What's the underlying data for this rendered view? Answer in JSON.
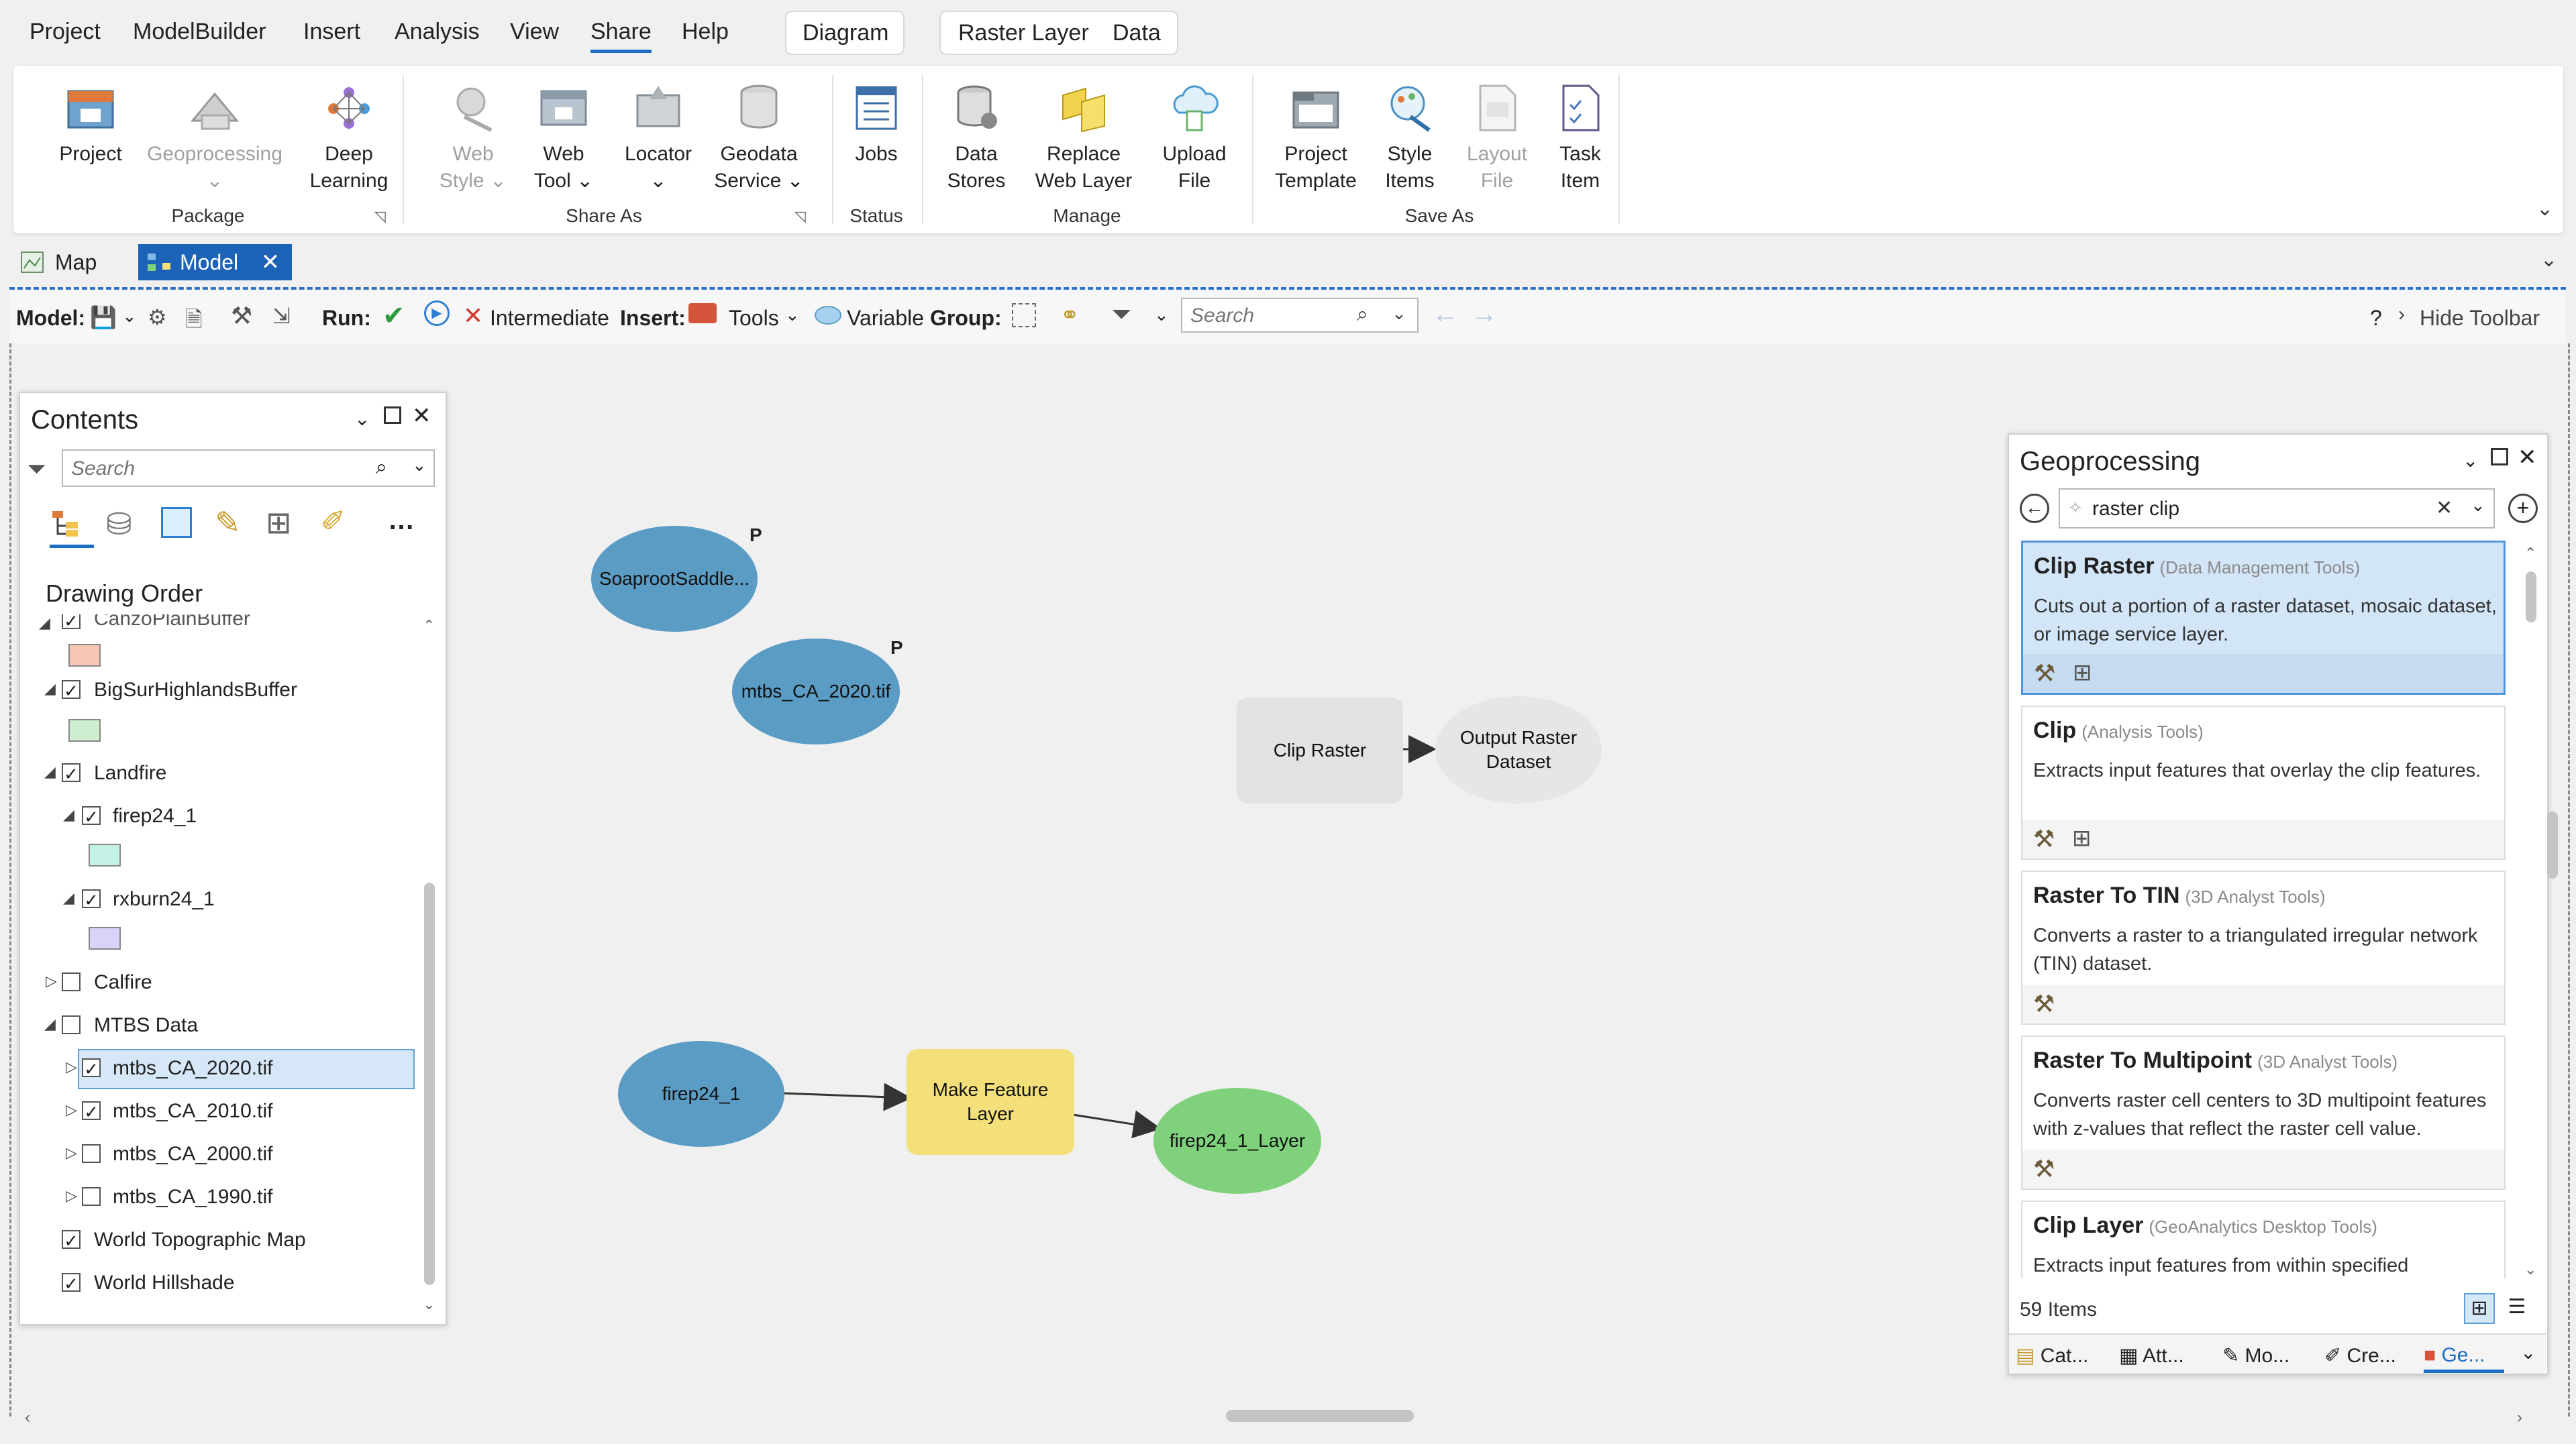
{
  "menu": {
    "items": [
      "Project",
      "ModelBuilder",
      "Insert",
      "Analysis",
      "View",
      "Share",
      "Help"
    ],
    "active": "Share",
    "contextual": [
      "Diagram",
      "Raster Layer",
      "Data"
    ]
  },
  "ribbon": {
    "groups": {
      "package": "Package",
      "share_as": "Share As",
      "status": "Status",
      "manage": "Manage",
      "save_as": "Save As"
    },
    "buttons": {
      "project": "Project",
      "geoprocessing": "Geoprocessing",
      "deep_learning_1": "Deep",
      "deep_learning_2": "Learning",
      "web_style_1": "Web",
      "web_style_2": "Style",
      "web_tool_1": "Web",
      "web_tool_2": "Tool",
      "locator": "Locator",
      "geodata_1": "Geodata",
      "geodata_2": "Service",
      "jobs": "Jobs",
      "data_stores_1": "Data",
      "data_stores_2": "Stores",
      "replace_1": "Replace",
      "replace_2": "Web Layer",
      "upload_1": "Upload",
      "upload_2": "File",
      "ptemplate_1": "Project",
      "ptemplate_2": "Template",
      "style_items_1": "Style",
      "style_items_2": "Items",
      "layout_file_1": "Layout",
      "layout_file_2": "File",
      "task_item_1": "Task",
      "task_item_2": "Item"
    }
  },
  "view_tabs": [
    {
      "label": "Map",
      "active": false
    },
    {
      "label": "Model",
      "active": true
    }
  ],
  "toolbar": {
    "model_label": "Model:",
    "run_label": "Run:",
    "intermediate": "Intermediate",
    "insert_label": "Insert:",
    "tools": "Tools",
    "variable": "Variable",
    "group_label": "Group:",
    "search_placeholder": "Search",
    "hide_toolbar": "Hide Toolbar",
    "help": "?"
  },
  "contents": {
    "title": "Contents",
    "search_placeholder": "Search",
    "section": "Drawing Order",
    "truncated_top": "CanzoPlainBuffer",
    "layers": [
      {
        "label": "BigSurHighlandsBuffer",
        "checked": true
      },
      {
        "label": "Landfire",
        "checked": true
      },
      {
        "label": "firep24_1",
        "checked": true
      },
      {
        "label": "rxburn24_1",
        "checked": true
      },
      {
        "label": "Calfire",
        "checked": false
      },
      {
        "label": "MTBS Data",
        "checked": false
      },
      {
        "label": "mtbs_CA_2020.tif",
        "checked": true
      },
      {
        "label": "mtbs_CA_2010.tif",
        "checked": true
      },
      {
        "label": "mtbs_CA_2000.tif",
        "checked": false
      },
      {
        "label": "mtbs_CA_1990.tif",
        "checked": false
      },
      {
        "label": "World Topographic Map",
        "checked": true
      },
      {
        "label": "World Hillshade",
        "checked": true
      }
    ],
    "colors": {
      "canzo": "#f7c5b3",
      "bigsur": "#cdeecf",
      "firep": "#c4f1e6",
      "rxburn": "#d8d3f7"
    }
  },
  "model": {
    "nodes": {
      "soaproot": "SoaprootSaddle...",
      "mtbs": "mtbs_CA_2020.tif",
      "clip_raster": "Clip Raster",
      "output_1": "Output Raster",
      "output_2": "Dataset",
      "firep": "firep24_1",
      "make_1": "Make Feature",
      "make_2": "Layer",
      "firep_layer": "firep24_1_Layer"
    },
    "badge": "P",
    "colors": {
      "input": "#5b9cc4",
      "tool_gray": "#e2e2e2",
      "tool_yellow": "#f4e07b",
      "output_green": "#7fd27b",
      "output_gray": "#e6e6e6"
    }
  },
  "geoprocessing": {
    "title": "Geoprocessing",
    "search_value": "raster clip",
    "results": [
      {
        "name": "Clip Raster",
        "toolbox": "(Data Management Tools)",
        "desc": "Cuts out a portion of a raster dataset, mosaic dataset, or image service layer.",
        "selected": true
      },
      {
        "name": "Clip",
        "toolbox": "(Analysis Tools)",
        "desc": "Extracts input features that overlay the clip features.",
        "selected": false
      },
      {
        "name": "Raster To TIN",
        "toolbox": "(3D Analyst Tools)",
        "desc": "Converts a raster to a triangulated  irregular network (TIN) dataset.",
        "selected": false
      },
      {
        "name": "Raster To Multipoint",
        "toolbox": "(3D Analyst Tools)",
        "desc": "Converts raster cell centers to 3D multipoint features with z-values that reflect the raster cell value.",
        "selected": false
      },
      {
        "name": "Clip Layer",
        "toolbox": "(GeoAnalytics Desktop Tools)",
        "desc": "Extracts input features from within specified polygons.",
        "selected": false
      }
    ],
    "count": "59 Items",
    "bottom_tabs": [
      "Cat...",
      "Att...",
      "Mo...",
      "Cre...",
      "Ge..."
    ]
  }
}
